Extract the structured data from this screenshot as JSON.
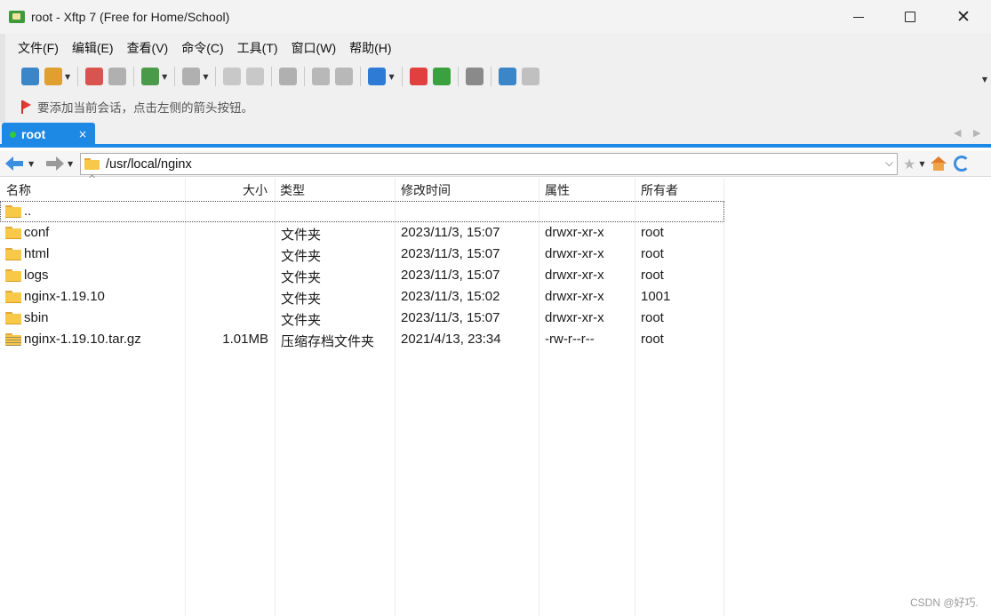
{
  "window": {
    "title": "root - Xftp 7 (Free for Home/School)",
    "min_icon": "minimize-icon",
    "max_icon": "maximize-icon",
    "close_glyph": "✕"
  },
  "menu": [
    "文件(F)",
    "编辑(E)",
    "查看(V)",
    "命令(C)",
    "工具(T)",
    "窗口(W)",
    "帮助(H)"
  ],
  "toolbar": {
    "buttons": [
      {
        "icon": "new-session-icon",
        "color": "#3a86c8",
        "dropdown": false
      },
      {
        "icon": "open-folder-icon",
        "color": "#e0a030",
        "dropdown": true
      },
      {
        "icon": "connect-icon",
        "color": "#d9534f",
        "dropdown": false
      },
      {
        "icon": "disconnect-icon",
        "color": "#b0b0b0",
        "dropdown": false
      },
      {
        "icon": "properties-icon",
        "color": "#4a9a4a",
        "dropdown": true
      },
      {
        "icon": "play-icon",
        "color": "#b0b0b0",
        "dropdown": true
      },
      {
        "icon": "transfer-up-icon",
        "color": "#c8c8c8",
        "dropdown": false
      },
      {
        "icon": "transfer-down-icon",
        "color": "#c8c8c8",
        "dropdown": false
      },
      {
        "icon": "sync-icon",
        "color": "#b0b0b0",
        "dropdown": false
      },
      {
        "icon": "copy-icon",
        "color": "#b8b8b8",
        "dropdown": false
      },
      {
        "icon": "paste-icon",
        "color": "#b8b8b8",
        "dropdown": false
      },
      {
        "icon": "globe-icon",
        "color": "#2e7bd6",
        "dropdown": true
      },
      {
        "icon": "xshell-icon",
        "color": "#e04040",
        "dropdown": false
      },
      {
        "icon": "xftp-icon",
        "color": "#3aa040",
        "dropdown": false
      },
      {
        "icon": "settings-gear-icon",
        "color": "#8a8a8a",
        "dropdown": false
      },
      {
        "icon": "help-icon",
        "color": "#3a86c8",
        "dropdown": false
      },
      {
        "icon": "chat-icon",
        "color": "#c0c0c0",
        "dropdown": false
      }
    ],
    "separators_after": [
      1,
      3,
      4,
      5,
      7,
      8,
      10,
      11,
      13,
      14
    ]
  },
  "hint": "要添加当前会话，点击左侧的箭头按钮。",
  "tab": {
    "label": "root",
    "close": "×",
    "status_color": "#32cd32"
  },
  "address": {
    "path": "/usr/local/nginx"
  },
  "columns": [
    "名称",
    "大小",
    "类型",
    "修改时间",
    "属性",
    "所有者"
  ],
  "files": [
    {
      "name": "..",
      "size": "",
      "type": "",
      "modified": "",
      "perm": "",
      "owner": "",
      "kind": "folder"
    },
    {
      "name": "conf",
      "size": "",
      "type": "文件夹",
      "modified": "2023/11/3, 15:07",
      "perm": "drwxr-xr-x",
      "owner": "root",
      "kind": "folder"
    },
    {
      "name": "html",
      "size": "",
      "type": "文件夹",
      "modified": "2023/11/3, 15:07",
      "perm": "drwxr-xr-x",
      "owner": "root",
      "kind": "folder"
    },
    {
      "name": "logs",
      "size": "",
      "type": "文件夹",
      "modified": "2023/11/3, 15:07",
      "perm": "drwxr-xr-x",
      "owner": "root",
      "kind": "folder"
    },
    {
      "name": "nginx-1.19.10",
      "size": "",
      "type": "文件夹",
      "modified": "2023/11/3, 15:02",
      "perm": "drwxr-xr-x",
      "owner": "1001",
      "kind": "folder"
    },
    {
      "name": "sbin",
      "size": "",
      "type": "文件夹",
      "modified": "2023/11/3, 15:07",
      "perm": "drwxr-xr-x",
      "owner": "root",
      "kind": "folder"
    },
    {
      "name": "nginx-1.19.10.tar.gz",
      "size": "1.01MB",
      "type": "压缩存档文件夹",
      "modified": "2021/4/13, 23:34",
      "perm": "-rw-r--r--",
      "owner": "root",
      "kind": "archive"
    }
  ],
  "watermark": "CSDN @好巧."
}
